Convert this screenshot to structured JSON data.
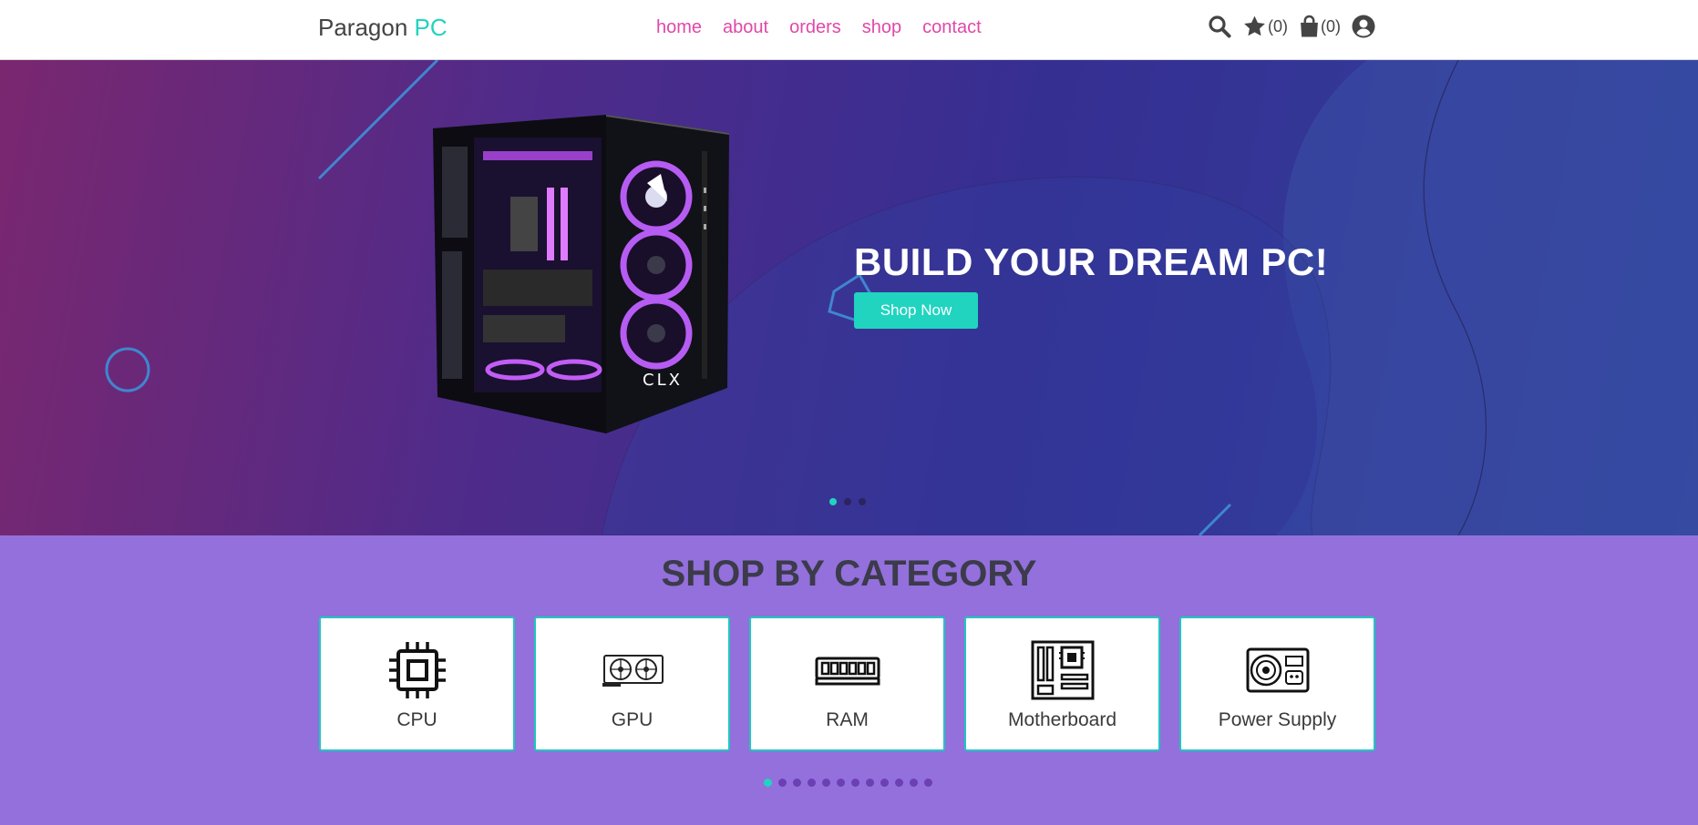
{
  "header": {
    "brand": "Paragon",
    "brand_accent": "PC",
    "nav": [
      "home",
      "about",
      "orders",
      "shop",
      "contact"
    ],
    "wishlist_count": "(0)",
    "cart_count": "(0)"
  },
  "hero": {
    "title": "BUILD YOUR DREAM PC!",
    "cta": "Shop Now",
    "pc_label": "CLX",
    "slide_count": 3,
    "active_slide": 1
  },
  "categories": {
    "title": "SHOP BY CATEGORY",
    "items": [
      {
        "label": "CPU",
        "icon": "cpu-icon"
      },
      {
        "label": "GPU",
        "icon": "gpu-icon"
      },
      {
        "label": "RAM",
        "icon": "ram-icon"
      },
      {
        "label": "Motherboard",
        "icon": "motherboard-icon"
      },
      {
        "label": "Power Supply",
        "icon": "power-supply-icon"
      }
    ],
    "page_count": 12,
    "active_page": 1
  },
  "colors": {
    "accent": "#20d4c0",
    "nav_link": "#e048a8",
    "category_bg": "#9370db"
  }
}
